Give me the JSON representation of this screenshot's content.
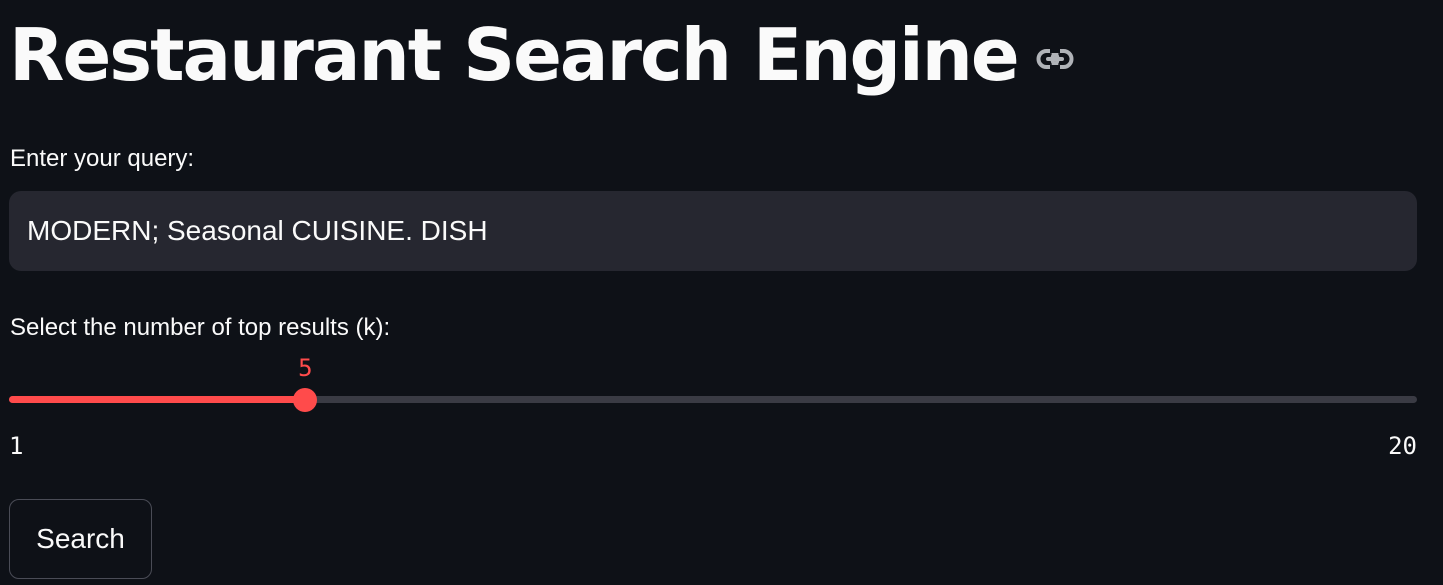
{
  "header": {
    "title": "Restaurant Search Engine",
    "anchor_icon": "link-icon"
  },
  "query": {
    "label": "Enter your query:",
    "value": "MODERN; Seasonal CUISINE. DISH",
    "placeholder": ""
  },
  "slider": {
    "label": "Select the number of top results (k):",
    "value": 5,
    "min": 1,
    "max": 20,
    "min_label": "1",
    "max_label": "20",
    "value_label": "5"
  },
  "actions": {
    "search_label": "Search"
  },
  "colors": {
    "background": "#0e1117",
    "accent": "#ff4b4b",
    "input_bg": "#262730",
    "text": "#fafafa"
  }
}
